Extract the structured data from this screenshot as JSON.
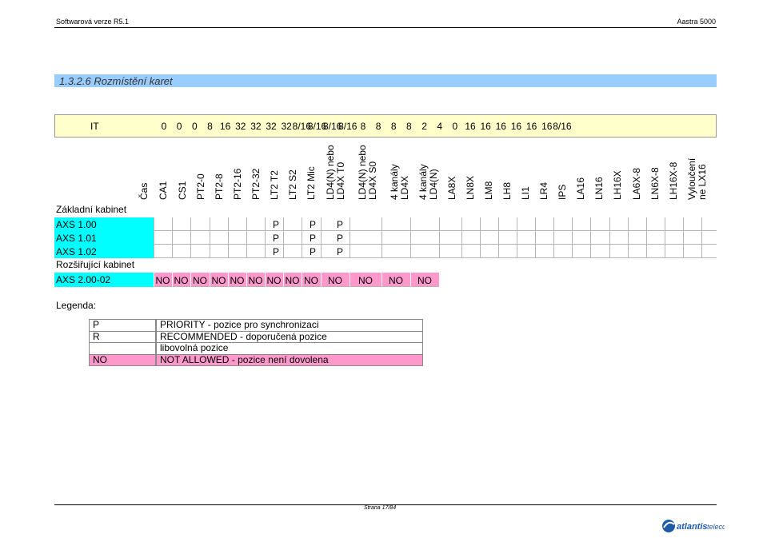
{
  "header": {
    "left": "Softwarová verze R5.1",
    "right": "Aastra 5000"
  },
  "section": {
    "title": "1.3.2.6 Rozmístění karet"
  },
  "capacity": {
    "label": "IT",
    "values": [
      "0",
      "0",
      "0",
      "8",
      "16",
      "32",
      "32",
      "32",
      "32",
      "8/16",
      "8/16",
      "8/16",
      "8/16",
      "8",
      "8",
      "8",
      "8",
      "2",
      "4",
      "0",
      "16",
      "16",
      "16",
      "16",
      "16",
      "16",
      "8/16"
    ]
  },
  "columns": [
    "Čas",
    "CA1",
    "CS1",
    "PT2-0",
    "PT2-8",
    "PT2-16",
    "PT2-32",
    "LT2 T2",
    "LT2 S2",
    "LT2 Mic",
    "LD4(N) nebo\nLD4X T0",
    "LD4(N) nebo\nLD4X S0",
    "4 kanály\nLD4X",
    "4 kanály\nLD4(N)",
    "LA8X",
    "LN8X",
    "LM8",
    "LH8",
    "LI1",
    "LR4",
    "IPS",
    "LA16",
    "LN16",
    "LH16X",
    "LA6X-8",
    "LN6X-8",
    "LH16X-8",
    "Vyloučení\nne LX16"
  ],
  "rows": {
    "basic_label": "Základní kabinet",
    "basic": [
      {
        "name": "AXS 1.00",
        "marks": [
          "P",
          "P",
          "P"
        ]
      },
      {
        "name": "AXS 1.01",
        "marks": [
          "P",
          "P",
          "P"
        ]
      },
      {
        "name": "AXS 1.02",
        "marks": [
          "P",
          "P",
          "P"
        ]
      }
    ],
    "ext_label": "Rozšiřující kabinet",
    "ext": [
      {
        "name": "AXS 2.00-02",
        "marks": [
          "NO",
          "NO",
          "NO",
          "NO",
          "NO",
          "NO",
          "NO",
          "NO",
          "NO",
          "NO",
          "NO",
          "NO",
          "NO"
        ]
      }
    ]
  },
  "legend": {
    "title": "Legenda:",
    "items": [
      {
        "code": "P",
        "text": "PRIORITY - pozice pro synchronizaci",
        "color": "#ffffff"
      },
      {
        "code": "R",
        "text": "RECOMMENDED - doporučená pozice",
        "color": "#ffffff"
      },
      {
        "code": "",
        "text": "libovolná pozice",
        "color": "#ffffff"
      },
      {
        "code": "NO",
        "text": "NOT ALLOWED - pozice není dovolena",
        "color": "#ff99cc"
      }
    ]
  },
  "footer": {
    "page": "Strana 17/84",
    "logo": "atlantis telecom"
  },
  "colors": {
    "section_bar": "#99ccff",
    "capacity_row": "#ffffcc",
    "row_highlight": "#00ffff",
    "not_allowed": "#ff99cc"
  }
}
